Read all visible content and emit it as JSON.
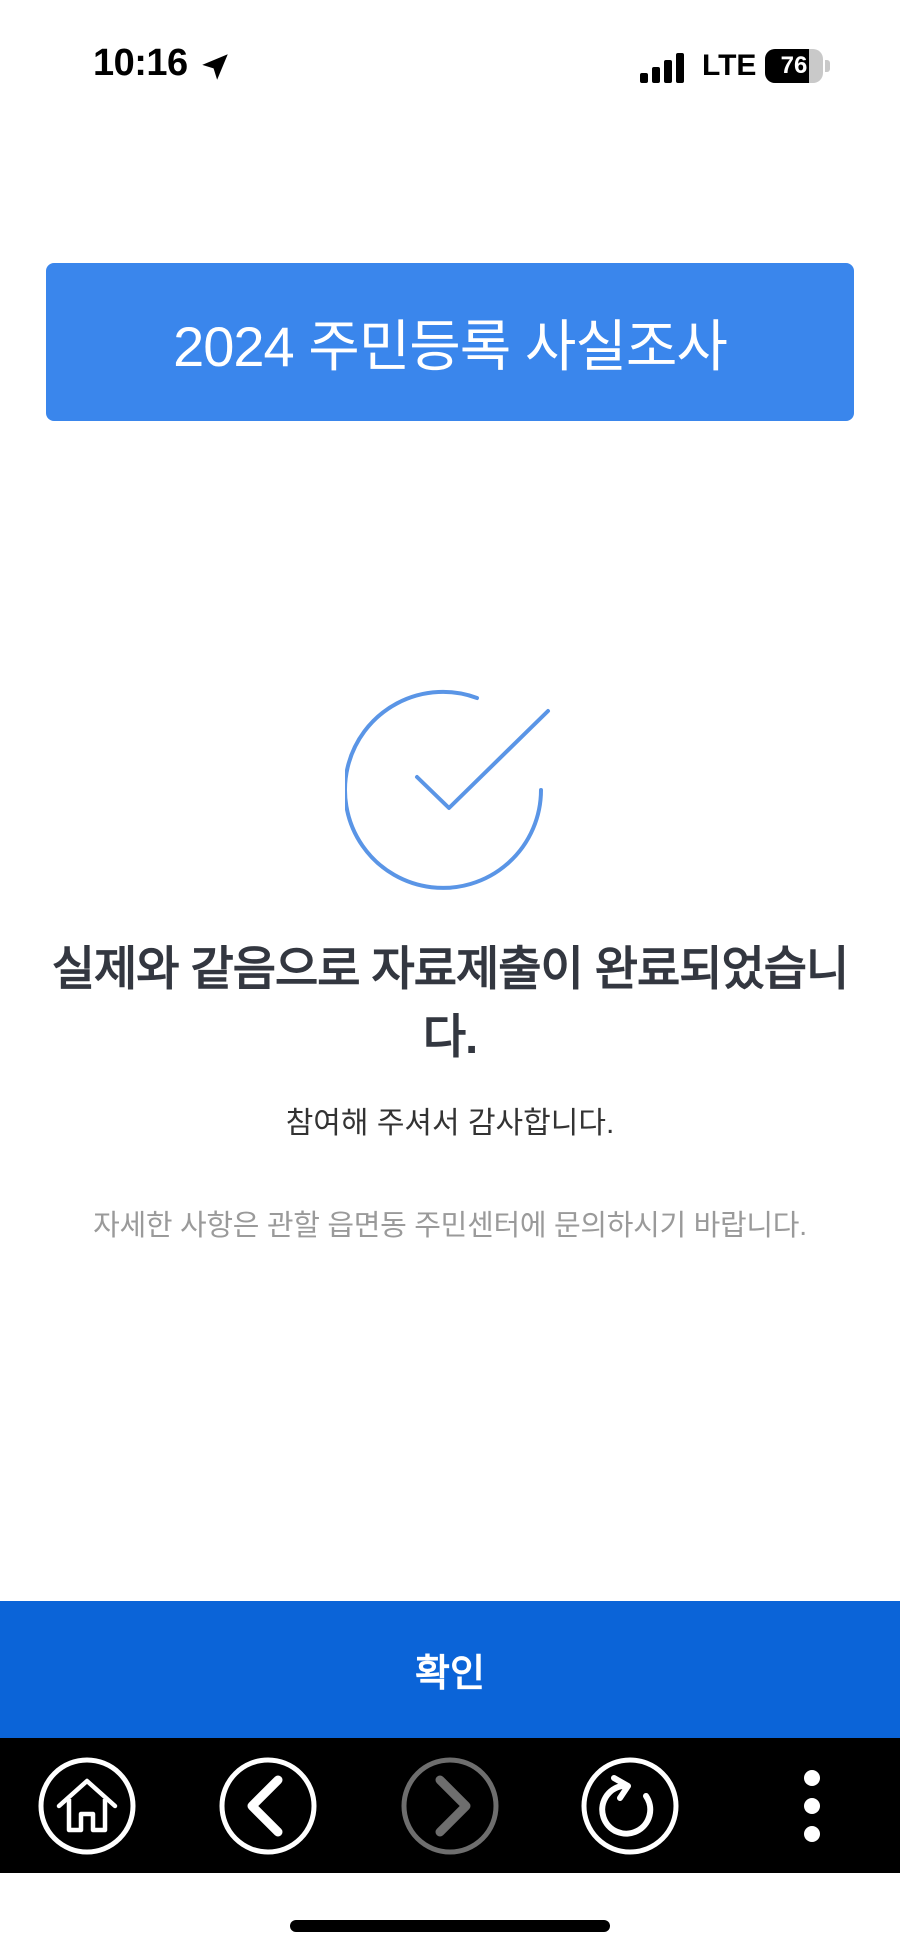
{
  "status_bar": {
    "time": "10:16",
    "network": "LTE",
    "battery": "76",
    "battery_level": 0.76
  },
  "banner": {
    "title": "2024 주민등록 사실조사"
  },
  "result": {
    "icon": "checkmark-circle-icon",
    "message": "실제와 같음으로 자료제출이 완료되었습니다.",
    "thanks": "참여해 주셔서 감사합니다.",
    "info": "자세한 사항은 관할 읍면동 주민센터에 문의하시기 바랍니다."
  },
  "confirm_button": {
    "label": "확인"
  },
  "toolbar": {
    "items": [
      {
        "icon": "home-icon"
      },
      {
        "icon": "back-icon"
      },
      {
        "icon": "forward-icon",
        "disabled": true
      },
      {
        "icon": "refresh-icon"
      },
      {
        "icon": "more-icon"
      }
    ]
  },
  "colors": {
    "banner": "#3a86ec",
    "confirm": "#0b64d8",
    "check": "#5a95e6",
    "toolbar": "#000000"
  }
}
